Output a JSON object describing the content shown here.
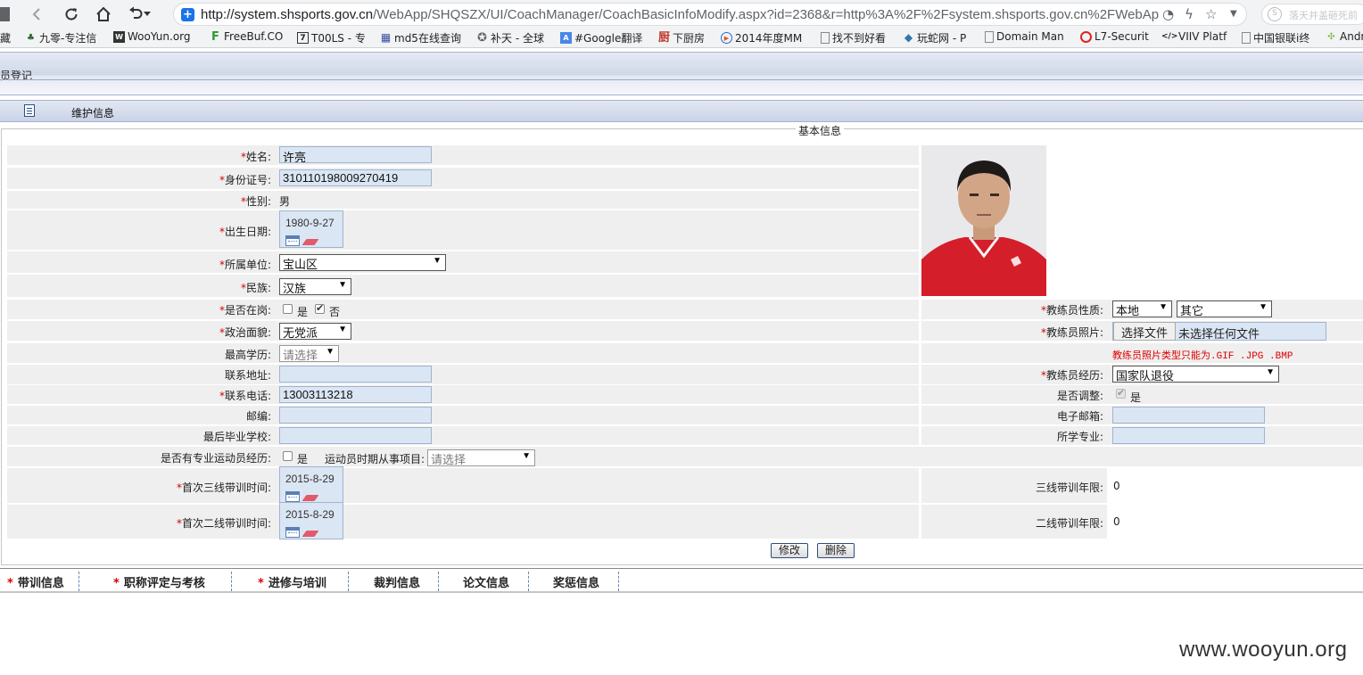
{
  "browser": {
    "url_host": "http://system.shsports.gov.cn",
    "url_rest": "/WebApp/SHQSZX/UI/CoachManager/CoachBasicInfoModify.aspx?id=2368&r=http%3A%2F%2Fsystem.shsports.gov.cn%2FWebApp",
    "search_ext_text": "落天并盖砸死前",
    "bookmarks": [
      {
        "label": "藏"
      },
      {
        "label": "九零-专注信"
      },
      {
        "label": "WooYun.org"
      },
      {
        "label": "FreeBuf.CO"
      },
      {
        "label": "T00LS - 专"
      },
      {
        "label": "md5在线查询"
      },
      {
        "label": "补天 - 全球"
      },
      {
        "label": "#Google翻译"
      },
      {
        "label": "下厨房"
      },
      {
        "label": "2014年度MM"
      },
      {
        "label": "找不到好看"
      },
      {
        "label": "玩蛇网 - P"
      },
      {
        "label": "Domain Man"
      },
      {
        "label": "L7-Securit"
      },
      {
        "label": "VIIV Platf"
      },
      {
        "label": "中国银联i终"
      },
      {
        "label": "Andr"
      }
    ]
  },
  "page": {
    "title": "员登记",
    "subheader": "维护信息",
    "legend": "基本信息"
  },
  "form": {
    "name_label": "姓名:",
    "name_value": "许亮",
    "idcard_label": "身份证号:",
    "idcard_value": "310110198009270419",
    "gender_label": "性别:",
    "gender_value": "男",
    "birth_label": "出生日期:",
    "birth_value": "1980-9-27",
    "unit_label": "所属单位:",
    "unit_value": "宝山区",
    "ethnic_label": "民族:",
    "ethnic_value": "汉族",
    "onduty_label": "是否在岗:",
    "yes": "是",
    "no": "否",
    "political_label": "政治面貌:",
    "political_value": "无党派",
    "education_label": "最高学历:",
    "education_value": "请选择",
    "address_label": "联系地址:",
    "address_value": "",
    "phone_label": "联系电话:",
    "phone_value": "13003113218",
    "postcode_label": "邮编:",
    "postcode_value": "",
    "school_label": "最后毕业学校:",
    "school_value": "",
    "athlete_label": "是否有专业运动员经历:",
    "athlete_project_label": "运动员时期从事项目:",
    "athlete_project_value": "请选择",
    "third_line_label": "首次三线带训时间:",
    "third_line_value": "2015-8-29",
    "second_line_label": "首次二线带训时间:",
    "second_line_value": "2015-8-29",
    "coach_type_label": "教练员性质:",
    "coach_type_value1": "本地",
    "coach_type_value2": "其它",
    "photo_label": "教练员照片:",
    "photo_button": "选择文件",
    "photo_status": "未选择任何文件",
    "photo_warning": "教练员照片类型只能为.GIF .JPG .BMP",
    "experience_label": "教练员经历:",
    "experience_value": "国家队退役",
    "adjusted_label": "是否调整:",
    "email_label": "电子邮箱:",
    "email_value": "",
    "major_label": "所学专业:",
    "major_value": "",
    "third_years_label": "三线带训年限:",
    "third_years_value": "0",
    "second_years_label": "二线带训年限:",
    "second_years_value": "0"
  },
  "actions": {
    "modify": "修改",
    "delete": "删除"
  },
  "tabs": [
    {
      "label": "带训信息",
      "required": true
    },
    {
      "label": "职称评定与考核",
      "required": true
    },
    {
      "label": "进修与培训",
      "required": true
    },
    {
      "label": "裁判信息",
      "required": false
    },
    {
      "label": "论文信息",
      "required": false
    },
    {
      "label": "奖惩信息",
      "required": false
    }
  ],
  "watermark": "www.wooyun.org",
  "req_mark": "*"
}
